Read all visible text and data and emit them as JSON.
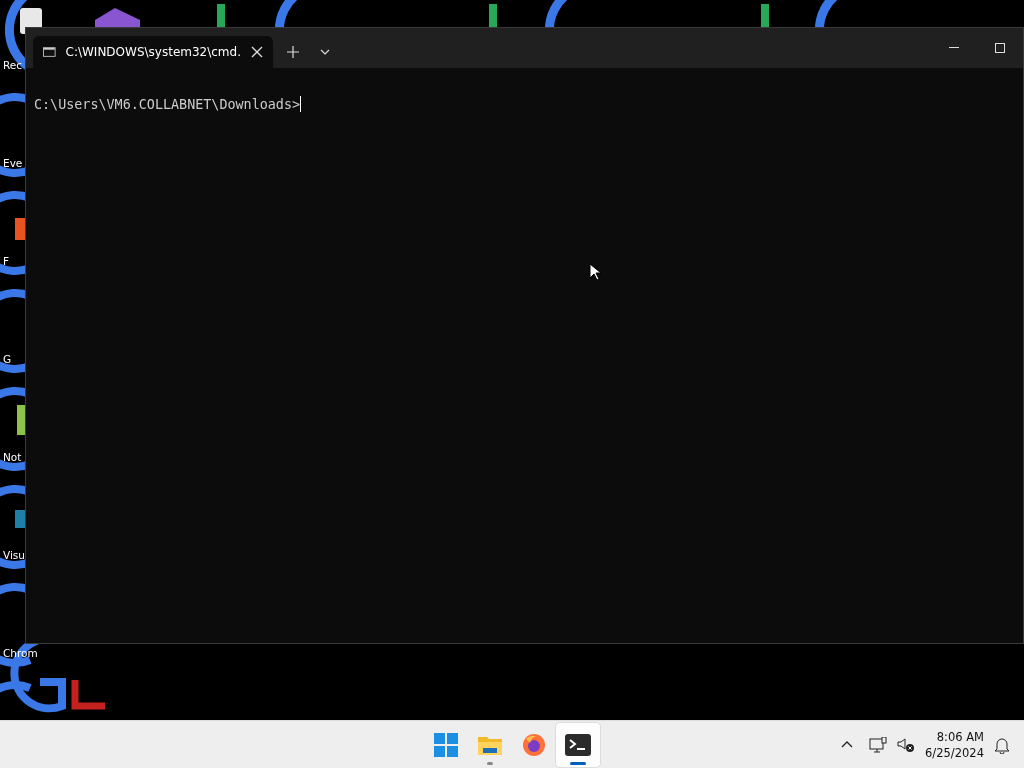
{
  "desktop": {
    "icons": [
      {
        "label": "Rec"
      },
      {
        "label": "Eve"
      },
      {
        "label": "F"
      },
      {
        "label": "G"
      },
      {
        "label": "Not"
      },
      {
        "label": "Visu"
      },
      {
        "label": "Chrom"
      }
    ]
  },
  "window": {
    "tabs": [
      {
        "title": "C:\\WINDOWS\\system32\\cmd.",
        "selected": true
      }
    ],
    "console": {
      "lines": [
        "C:\\Users\\VM6.COLLABNET\\Downloads>"
      ]
    }
  },
  "taskbar": {
    "apps": [
      {
        "kind": "start",
        "running": false,
        "selected": false
      },
      {
        "kind": "explorer",
        "running": true,
        "selected": false
      },
      {
        "kind": "firefox",
        "running": false,
        "selected": false
      },
      {
        "kind": "terminal",
        "running": true,
        "selected": true
      }
    ],
    "clock": {
      "time": "8:06 AM",
      "date": "6/25/2024"
    }
  }
}
